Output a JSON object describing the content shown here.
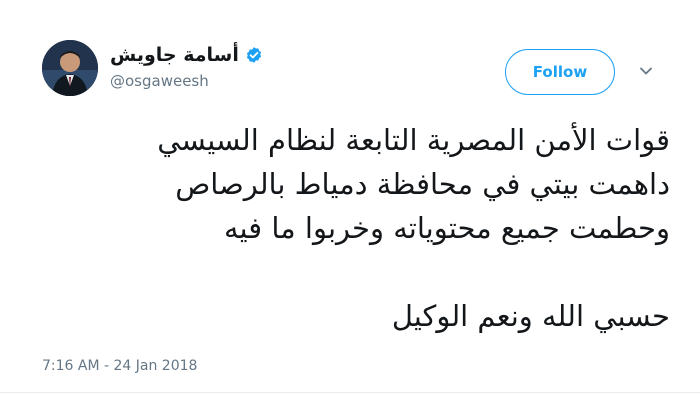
{
  "user": {
    "display_name": "أسامة جاويش",
    "handle": "@osgaweesh",
    "verified": true,
    "avatar_icon": "profile-photo"
  },
  "actions": {
    "follow_label": "Follow",
    "menu_icon": "chevron-down-icon"
  },
  "tweet": {
    "lines": [
      "قوات الأمن المصرية التابعة لنظام السيسي",
      "داهمت بيتي  في محافظة دمياط  بالرصاص",
      "وحطمت جميع محتوياته وخربوا ما فيه",
      "",
      "حسبي الله ونعم الوكيل"
    ],
    "timestamp": "7:16 AM - 24 Jan 2018"
  },
  "colors": {
    "accent": "#1da1f2",
    "text": "#14171a",
    "muted": "#657786"
  }
}
